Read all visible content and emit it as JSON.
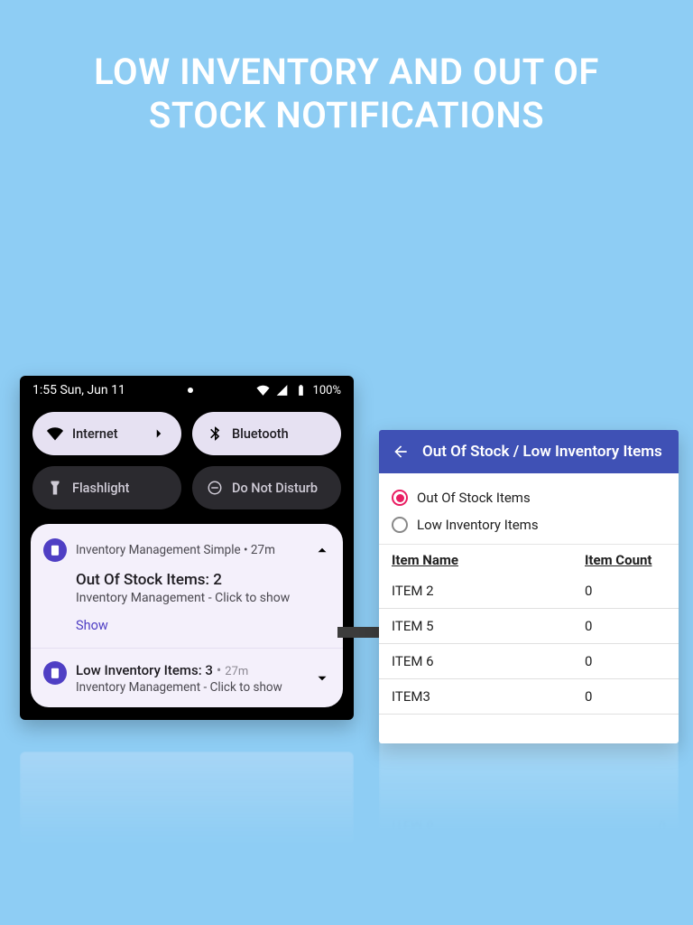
{
  "hero": {
    "title": "LOW INVENTORY AND OUT OF STOCK NOTIFICATIONS"
  },
  "statusbar": {
    "time_date": "1:55 Sun, Jun 11",
    "battery": "100%"
  },
  "quick_settings": {
    "internet": {
      "label": "Internet",
      "on": true
    },
    "bluetooth": {
      "label": "Bluetooth",
      "on": true
    },
    "flashlight": {
      "label": "Flashlight",
      "on": false
    },
    "dnd": {
      "label": "Do Not Disturb",
      "on": false
    }
  },
  "notification": {
    "app_name": "Inventory Management Simple",
    "age": "27m",
    "title": "Out Of Stock Items: 2",
    "body": "Inventory Management  - Click to show",
    "action": "Show",
    "second": {
      "title_prefix": "Low Inventory Items: 3",
      "age": "27m",
      "body": "Inventory Management  - Click to show"
    }
  },
  "app_panel": {
    "bar_title": "Out Of Stock / Low Inventory Items",
    "radios": {
      "out_of_stock": "Out Of Stock Items",
      "low_inventory": "Low Inventory Items"
    },
    "columns": {
      "name": "Item Name",
      "count": "Item Count"
    },
    "rows": [
      {
        "name": "ITEM 2",
        "count": "0"
      },
      {
        "name": "ITEM 5",
        "count": "0"
      },
      {
        "name": "ITEM 6",
        "count": "0"
      },
      {
        "name": "ITEM3",
        "count": "0"
      }
    ]
  }
}
